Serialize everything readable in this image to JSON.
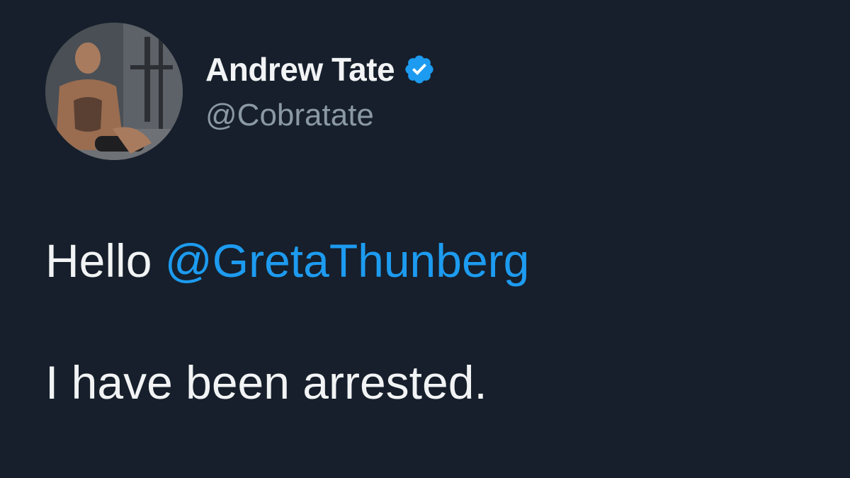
{
  "author": {
    "display_name": "Andrew Tate",
    "handle": "@Cobratate",
    "verified_badge_icon": "verified-check-icon",
    "avatar_icon": "profile-photo"
  },
  "tweet": {
    "greeting": "Hello",
    "mention": "@GretaThunberg",
    "message": "I have been arrested."
  },
  "colors": {
    "background": "#161f2b",
    "text": "#f1f3f4",
    "handle": "#8b98a5",
    "mention": "#1d9bf0",
    "verified": "#1d9bf0"
  }
}
